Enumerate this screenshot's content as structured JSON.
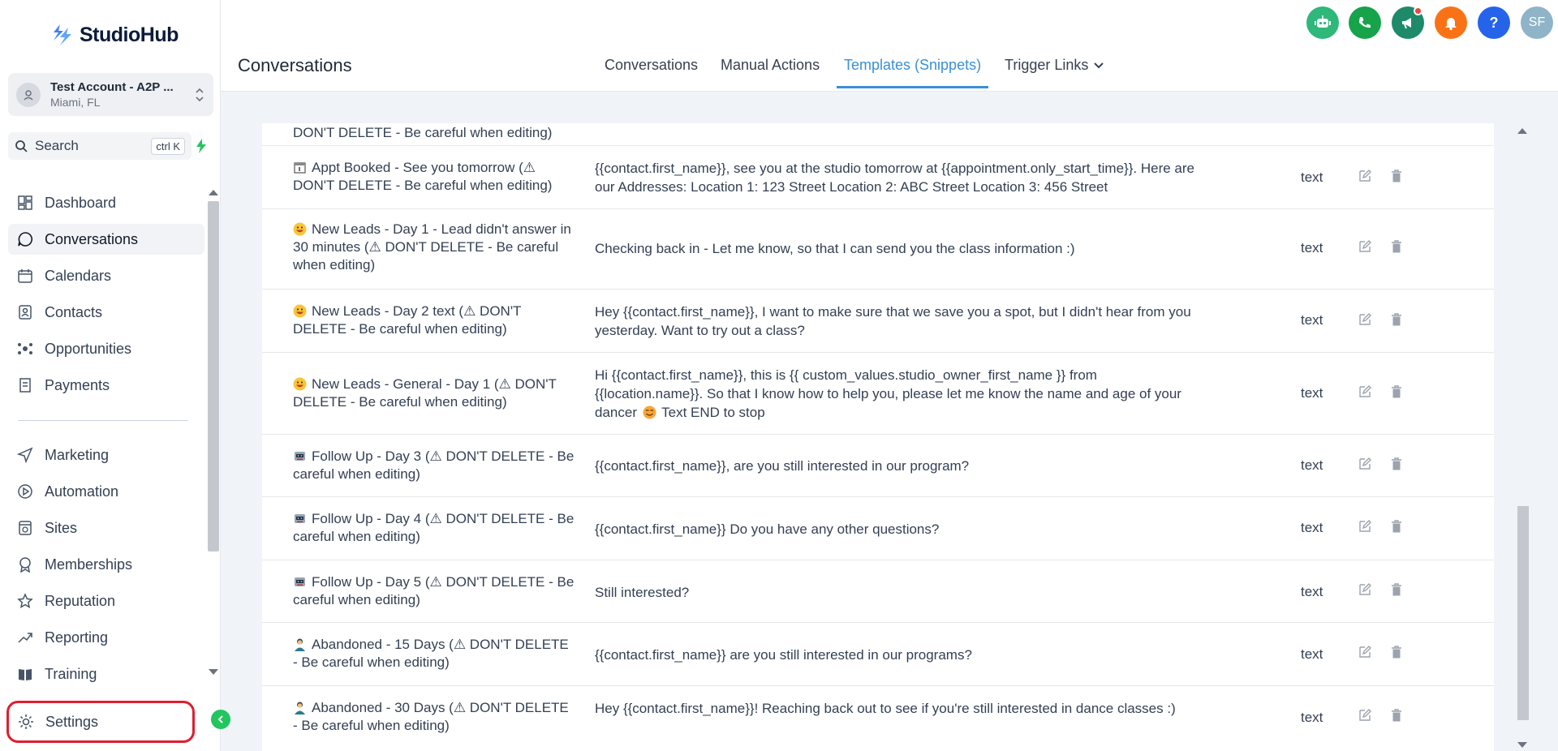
{
  "brand": {
    "name": "StudioHub"
  },
  "account": {
    "name": "Test Account - A2P ...",
    "location": "Miami, FL"
  },
  "search": {
    "label": "Search",
    "shortcut": "ctrl K"
  },
  "nav": {
    "primary": [
      "Dashboard",
      "Conversations",
      "Calendars",
      "Contacts",
      "Opportunities",
      "Payments"
    ],
    "secondary": [
      "Marketing",
      "Automation",
      "Sites",
      "Memberships",
      "Reputation",
      "Reporting",
      "Training"
    ],
    "active": "Conversations",
    "settings": "Settings"
  },
  "header": {
    "title": "Conversations",
    "tabs": [
      "Conversations",
      "Manual Actions",
      "Templates (Snippets)",
      "Trigger Links"
    ],
    "active_tab": "Templates (Snippets)",
    "avatar_initials": "SF",
    "help": "?"
  },
  "colors": {
    "accent": "#3a8fd9",
    "green": "#22c55e",
    "highlight": "#e11d2e"
  },
  "templates": [
    {
      "name": "DON'T DELETE - Be careful when editing)",
      "body": "",
      "type": ""
    },
    {
      "icon": "calendar",
      "name": "Appt Booked - See you tomorrow (⚠ DON'T DELETE - Be careful when editing)",
      "body": "{{contact.first_name}}, see you at the studio tomorrow at {{appointment.only_start_time}}. Here are our Addresses: Location 1: 123 Street Location 2: ABC Street Location 3: 456 Street",
      "type": "text"
    },
    {
      "icon": "grin",
      "name": "New Leads - Day 1 - Lead didn't answer in 30 minutes (⚠ DON'T DELETE - Be careful when editing)",
      "body": "Checking back in - Let me know, so that I can send you the class information :)",
      "type": "text"
    },
    {
      "icon": "grin",
      "name": "New Leads - Day 2 text (⚠ DON'T DELETE - Be careful when editing)",
      "body": "Hey {{contact.first_name}}, I want to make sure that we save you a spot, but I didn't hear from you yesterday. Want to try out a class?",
      "type": "text"
    },
    {
      "icon": "grin",
      "name": "New Leads - General - Day 1 (⚠ DON'T DELETE - Be careful when editing)",
      "body_before": "Hi {{contact.first_name}}, this is {{ custom_values.studio_owner_first_name }} from {{location.name}}. So that I know how to help you, please let me know the name and age of your dancer",
      "body_after": "Text END to stop",
      "type": "text"
    },
    {
      "icon": "robot",
      "name": "Follow Up - Day 3 (⚠ DON'T DELETE - Be careful when editing)",
      "body": "{{contact.first_name}}, are you still interested in our program?",
      "type": "text"
    },
    {
      "icon": "robot",
      "name": "Follow Up - Day 4 (⚠ DON'T DELETE - Be careful when editing)",
      "body": "{{contact.first_name}} Do you have any other questions?",
      "type": "text"
    },
    {
      "icon": "robot",
      "name": "Follow Up - Day 5 (⚠ DON'T DELETE - Be careful when editing)",
      "body": "Still interested?",
      "type": "text"
    },
    {
      "icon": "person",
      "name": "Abandoned - 15 Days (⚠ DON'T DELETE - Be careful when editing)",
      "body": "{{contact.first_name}} are you still interested in our programs?",
      "type": "text"
    },
    {
      "icon": "person",
      "name": "Abandoned - 30 Days (⚠ DON'T DELETE - Be careful when editing)",
      "body": "Hey {{contact.first_name}}! Reaching back out to see if you're still interested in dance classes :)",
      "type": "text"
    }
  ]
}
